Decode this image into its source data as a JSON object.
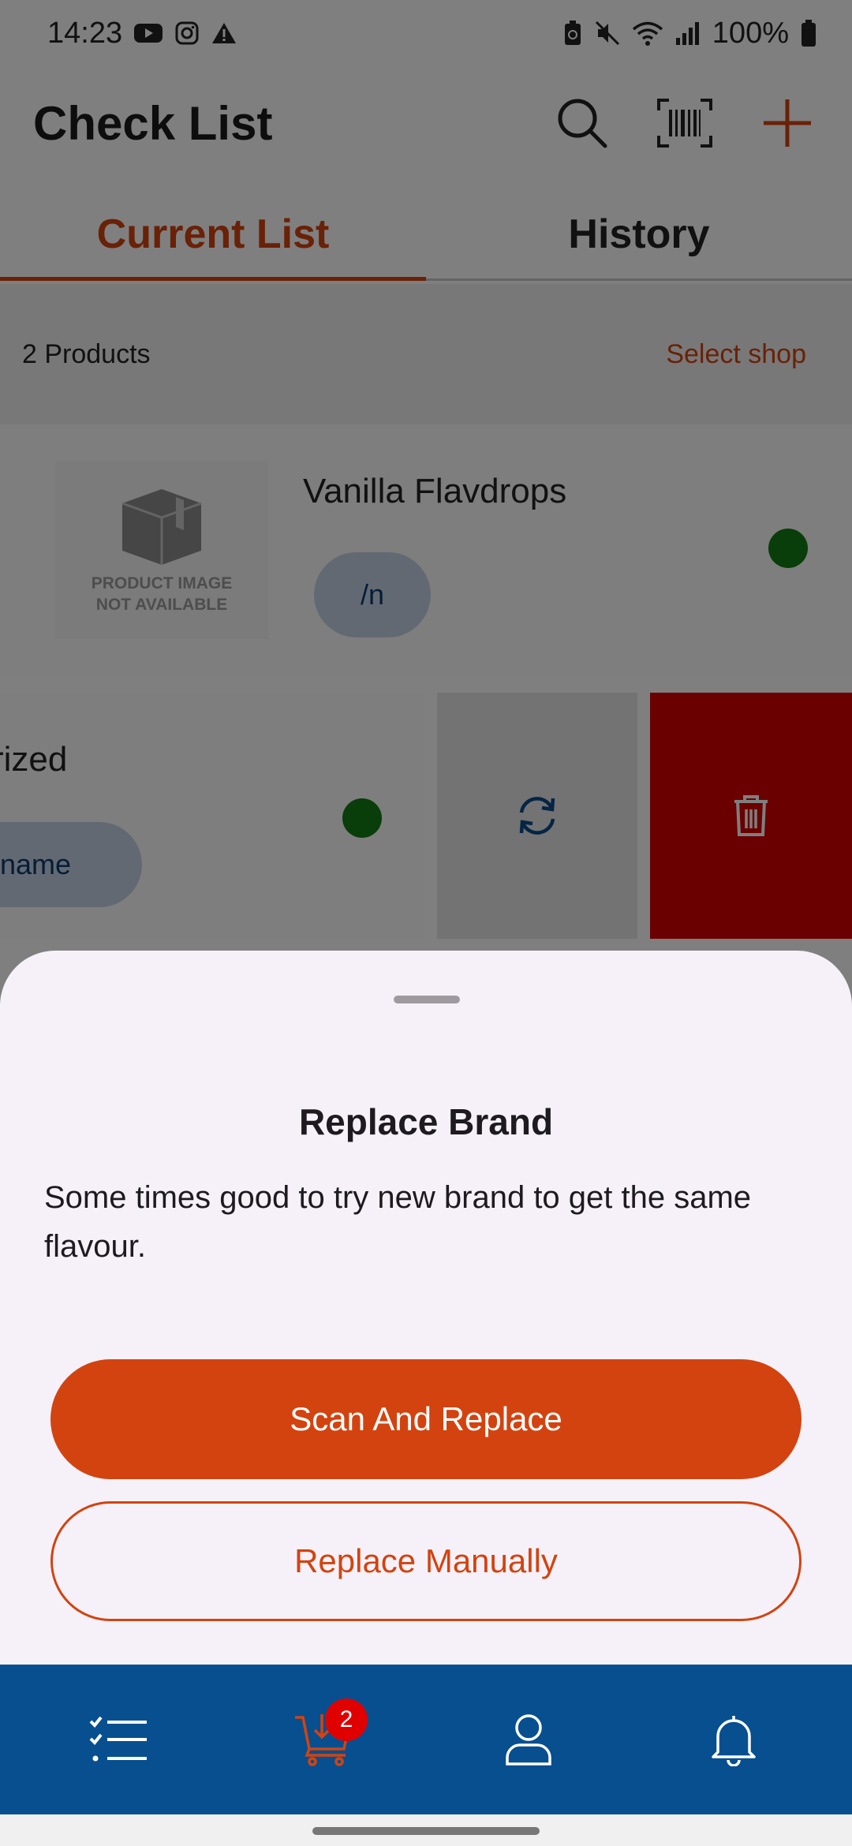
{
  "status_bar": {
    "time": "14:23",
    "battery": "100%"
  },
  "app_bar": {
    "title": "Check List"
  },
  "tabs": [
    {
      "label": "Current List",
      "active": true
    },
    {
      "label": "History",
      "active": false
    }
  ],
  "summary": {
    "count": "2 Products",
    "select_shop": "Select shop"
  },
  "products": [
    {
      "name": "Vanilla Flavdrops",
      "unit": "/n",
      "image_placeholder_line1": "PRODUCT IMAGE",
      "image_placeholder_line2": "NOT AVAILABLE",
      "status_color": "#137a13"
    },
    {
      "name": "rized",
      "unit": "d name",
      "status_color": "#137a13"
    }
  ],
  "sheet": {
    "title": "Replace Brand",
    "description": "Some times good to try new brand to get the same flavour.",
    "primary_button": "Scan And Replace",
    "secondary_button": "Replace Manually"
  },
  "bottom_nav": {
    "cart_badge": "2"
  },
  "colors": {
    "accent": "#d3430f",
    "nav_background": "#074f8f",
    "delete": "#d40000"
  }
}
